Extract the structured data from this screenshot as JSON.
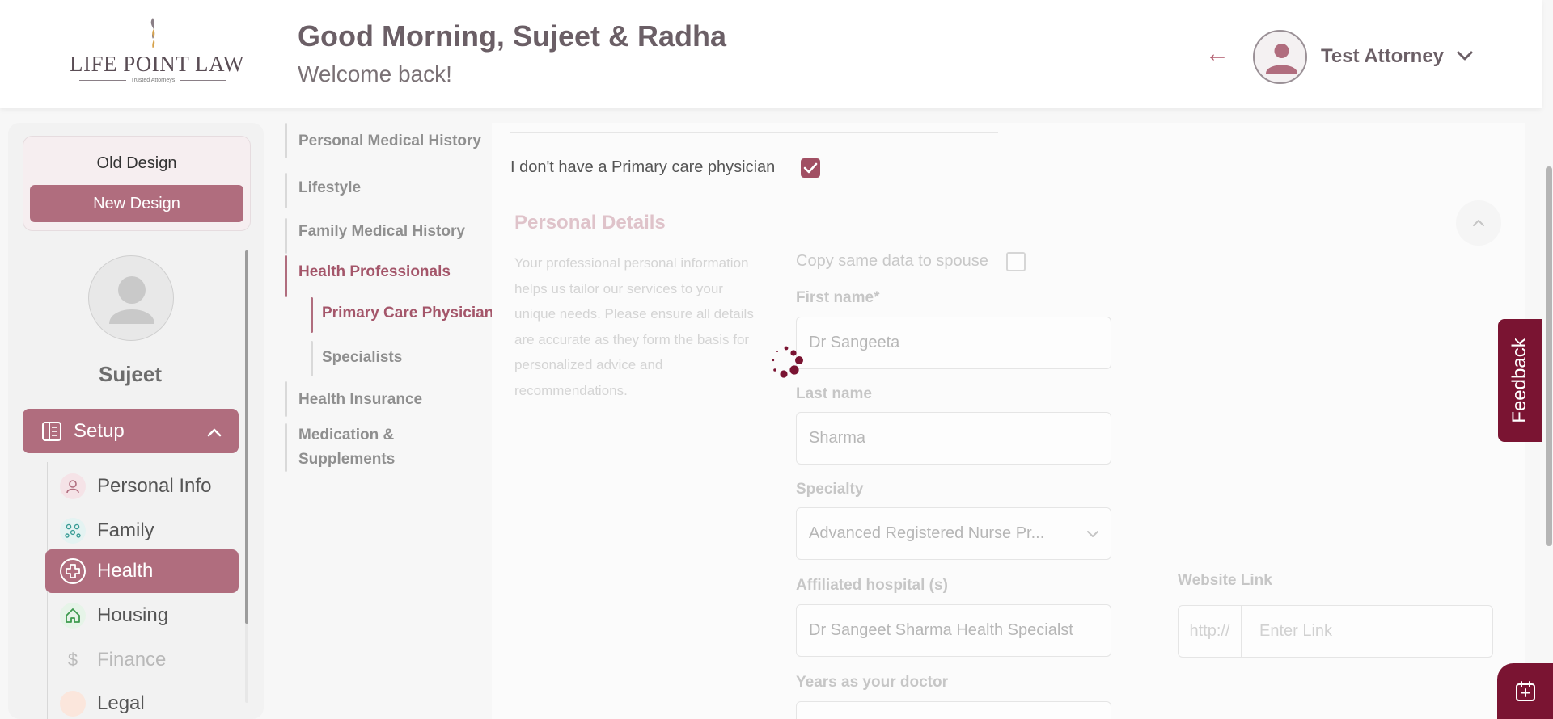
{
  "header": {
    "logo_text": "LIFE POINT LAW",
    "logo_tagline": "Trusted Attorneys",
    "greeting": "Good Morning, Sujeet & Radha",
    "welcome": "Welcome back!",
    "user_name": "Test Attorney"
  },
  "sidebar": {
    "old_design": "Old Design",
    "new_design": "New Design",
    "profile_name": "Sujeet",
    "setup_label": "Setup",
    "items": [
      {
        "label": "Personal Info",
        "icon": "person-icon"
      },
      {
        "label": "Family",
        "icon": "family-icon"
      },
      {
        "label": "Health",
        "icon": "medical-plus-icon"
      },
      {
        "label": "Housing",
        "icon": "house-icon"
      },
      {
        "label": "Finance",
        "icon": "dollar-icon"
      },
      {
        "label": "Legal",
        "icon": "legal-icon"
      }
    ],
    "active_item": "Health"
  },
  "health_nav": {
    "items": [
      "Personal Medical History",
      "Lifestyle",
      "Family Medical History",
      "Health Professionals",
      "Health Insurance",
      "Medication &",
      "Supplements"
    ],
    "sub_items": [
      "Primary Care Physician",
      "Specialists"
    ],
    "active_item": "Health Professionals",
    "active_sub_item": "Primary Care Physician"
  },
  "form": {
    "no_pcp_label": "I don't have a Primary care physician",
    "no_pcp_checked": true,
    "section_title": "Personal Details",
    "section_desc": "Your professional personal information helps us tailor our services to your unique needs. Please ensure all details are accurate as they form the basis for personalized advice and recommendations.",
    "copy_same_label": "Copy same data to spouse",
    "first_name_label": "First name*",
    "first_name_value": "Dr Sangeeta",
    "last_name_label": "Last name",
    "last_name_value": "Sharma",
    "specialty_label": "Specialty",
    "specialty_value": "Advanced Registered Nurse Pr...",
    "hospital_label": "Affiliated hospital (s)",
    "hospital_value": "Dr Sangeet Sharma Health Specialst",
    "website_label": "Website Link",
    "website_prefix": "http://",
    "website_placeholder": "Enter Link",
    "years_label": "Years as your doctor"
  },
  "feedback_label": "Feedback",
  "colors": {
    "brand": "#b06d7e",
    "brand_dark": "#7a1432",
    "checkbox": "#a14f63"
  }
}
